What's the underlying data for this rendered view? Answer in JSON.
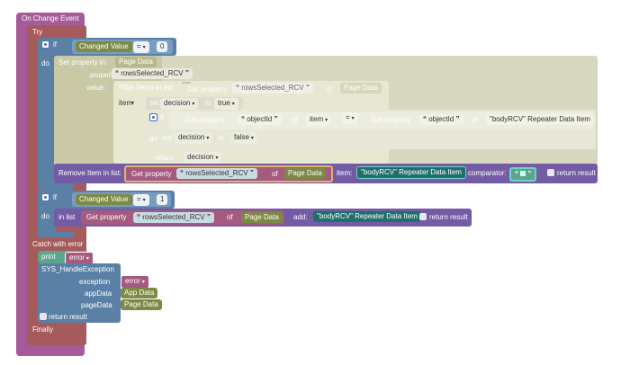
{
  "event": {
    "label": "On Change Event"
  },
  "try": {
    "label": "Try"
  },
  "if1": {
    "if_label": "if",
    "do_label": "do",
    "changed_value": "Changed Value",
    "op": "=",
    "value": "0"
  },
  "set_prop": {
    "label": "Set property in:",
    "target": "Page Data",
    "property_label": "property:",
    "property_value": "rowsSelected_RCV",
    "value_label": "value:"
  },
  "filter": {
    "label": "Filter items in list:",
    "get_property": "Get property",
    "prop": "rowsSelected_RCV",
    "of": "of",
    "of_target": "Page Data",
    "item_label": "item"
  },
  "set_decision": {
    "set": "set",
    "var": "decision",
    "to": "to",
    "value": "true"
  },
  "if2": {
    "if_label": "if",
    "do_label": "do",
    "get_property": "Get property",
    "prop": "objectId",
    "of": "of",
    "item": "item",
    "op": "=",
    "get_property_right": "Get property",
    "prop_right": "objectId",
    "of_right": "of",
    "target_right": "\"bodyRCV\" Repeater Data Item"
  },
  "set_decision2": {
    "set": "set",
    "var": "decision",
    "to": "to",
    "value": "false"
  },
  "return_decision": {
    "label": "return",
    "var": "decision"
  },
  "remove": {
    "label": "Remove Item in list:",
    "get_property": "Get property",
    "prop": "rowsSelected_RCV",
    "of": "of",
    "target": "Page Data",
    "item_label": "item:",
    "item_value": "\"bodyRCV\" Repeater Data Item",
    "comparator_label": "comparator:",
    "return_label": "return result"
  },
  "if3": {
    "if_label": "if",
    "do_label": "do",
    "changed_value": "Changed Value",
    "op": "=",
    "value": "1"
  },
  "add": {
    "label": "in list",
    "get_property": "Get property",
    "prop": "rowsSelected_RCV",
    "of": "of",
    "target": "Page Data",
    "add_label": "add:",
    "add_value": "\"bodyRCV\" Repeater Data Item",
    "return_label": "return result"
  },
  "catch": {
    "label": "Catch with error"
  },
  "print": {
    "label": "print",
    "value": "error"
  },
  "handle": {
    "label": "SYS_HandleException",
    "exception_label": "exception",
    "exception_value": "error",
    "appdata_label": "appData",
    "appdata_value": "App Data",
    "pagedata_label": "pageData",
    "pagedata_value": "Page Data",
    "return_label": "return result"
  },
  "finally": {
    "label": "Finally"
  },
  "colors": {
    "event": "#a55b9a",
    "try": "#a55b5b",
    "control": "#5b80a5",
    "page": "#9f9f6b",
    "list": "#745ba5",
    "logic": "#5b67a5",
    "var": "#a55b80",
    "text": "#5ba58c",
    "teal": "#1f6f6b",
    "filter": "#d8d8c0"
  }
}
